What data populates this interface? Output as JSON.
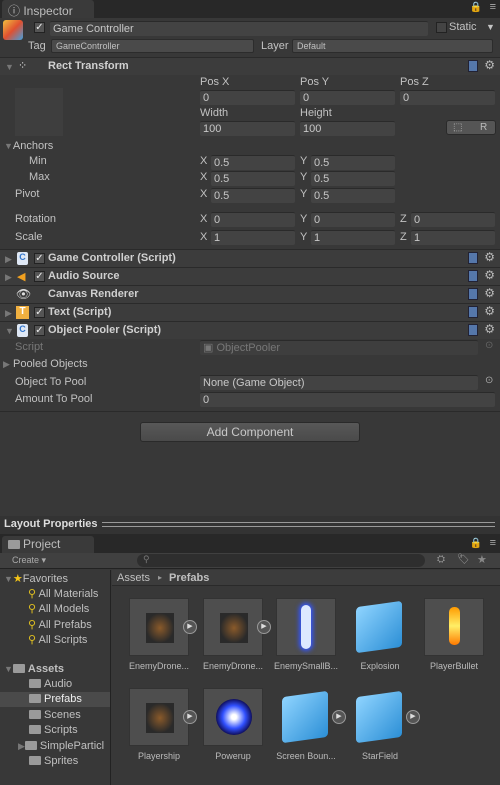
{
  "inspector": {
    "tab_label": "Inspector",
    "object_name": "Game Controller",
    "static_label": "Static",
    "tag_label": "Tag",
    "tag_value": "GameController",
    "layer_label": "Layer",
    "layer_value": "Default",
    "rect_transform": {
      "title": "Rect Transform",
      "pos_x_label": "Pos X",
      "pos_y_label": "Pos Y",
      "pos_z_label": "Pos Z",
      "pos_x": "0",
      "pos_y": "0",
      "pos_z": "0",
      "width_label": "Width",
      "height_label": "Height",
      "width": "100",
      "height": "100",
      "r_button": "R",
      "anchors_label": "Anchors",
      "min_label": "Min",
      "max_label": "Max",
      "min_x": "0.5",
      "min_y": "0.5",
      "max_x": "0.5",
      "max_y": "0.5",
      "pivot_label": "Pivot",
      "pivot_x": "0.5",
      "pivot_y": "0.5",
      "rotation_label": "Rotation",
      "rot_x": "0",
      "rot_y": "0",
      "rot_z": "0",
      "scale_label": "Scale",
      "scale_x": "1",
      "scale_y": "1",
      "scale_z": "1",
      "x": "X",
      "y": "Y",
      "z": "Z"
    },
    "components": [
      {
        "title": "Game Controller (Script)",
        "icon": "script-icon"
      },
      {
        "title": "Audio Source",
        "icon": "speaker-icon"
      },
      {
        "title": "Canvas Renderer",
        "icon": "eye-icon"
      },
      {
        "title": "Text (Script)",
        "icon": "text-icon"
      },
      {
        "title": "Object Pooler (Script)",
        "icon": "script-icon"
      }
    ],
    "object_pooler": {
      "script_label": "Script",
      "script_value": "ObjectPooler",
      "pooled_label": "Pooled Objects",
      "object_to_pool_label": "Object To Pool",
      "object_to_pool_value": "None (Game Object)",
      "amount_label": "Amount To Pool",
      "amount_value": "0"
    },
    "add_component": "Add Component"
  },
  "layout_properties": "Layout Properties",
  "project": {
    "tab_label": "Project",
    "create": "Create",
    "favorites": {
      "label": "Favorites",
      "items": [
        "All Materials",
        "All Models",
        "All Prefabs",
        "All Scripts"
      ]
    },
    "assets": {
      "label": "Assets",
      "items": [
        "Audio",
        "Prefabs",
        "Scenes",
        "Scripts",
        "SimpleParticl",
        "Sprites"
      ],
      "selected": "Prefabs"
    },
    "breadcrumb": [
      "Assets",
      "Prefabs"
    ],
    "prefabs": [
      "EnemyDrone...",
      "EnemyDrone...",
      "EnemySmallB...",
      "Explosion",
      "PlayerBullet",
      "Playership",
      "Powerup",
      "Screen Boun...",
      "StarField"
    ]
  }
}
